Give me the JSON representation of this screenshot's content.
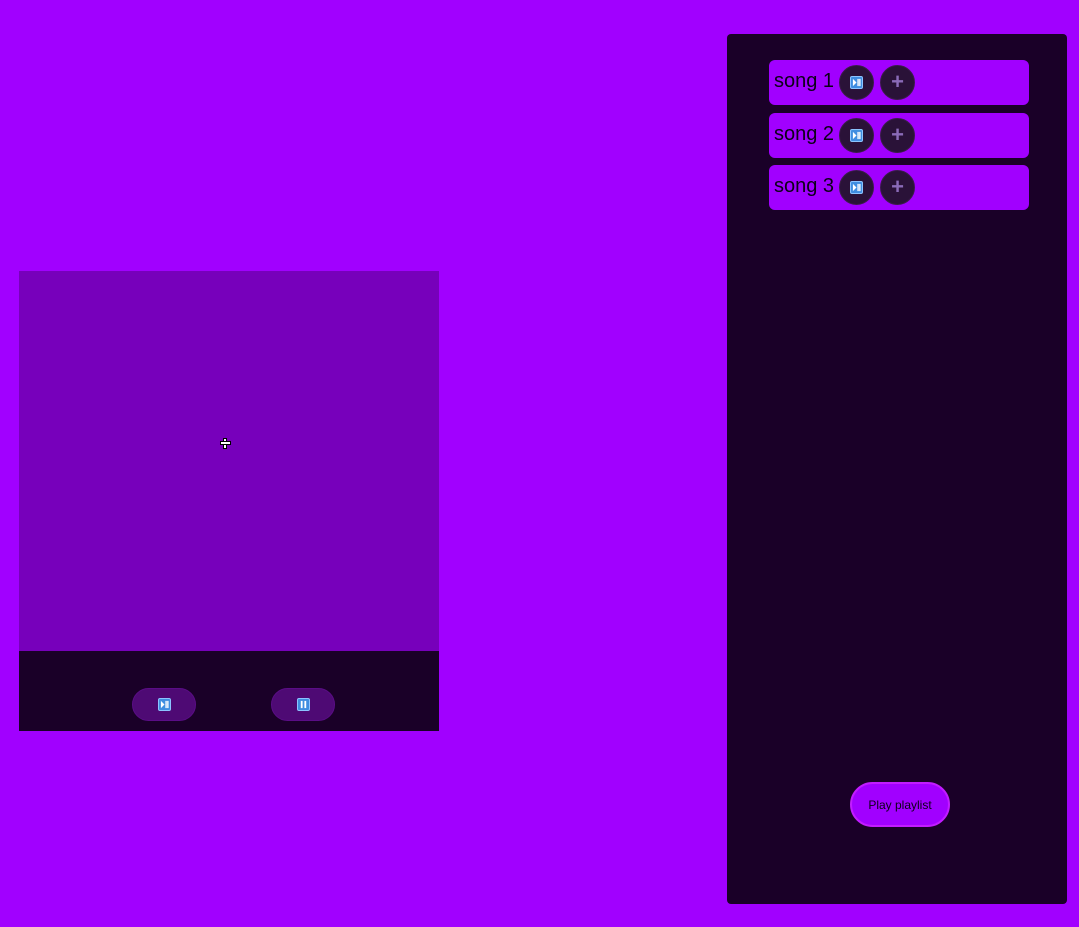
{
  "player": {
    "play_icon": "play-pause-icon",
    "pause_icon": "pause-icon"
  },
  "playlist": {
    "songs": [
      {
        "title": "song 1"
      },
      {
        "title": "song 2"
      },
      {
        "title": "song 3"
      }
    ],
    "play_button_label": "Play playlist"
  },
  "colors": {
    "background": "#a100ff",
    "panel": "#1a0028",
    "visual": "#7700bb"
  }
}
